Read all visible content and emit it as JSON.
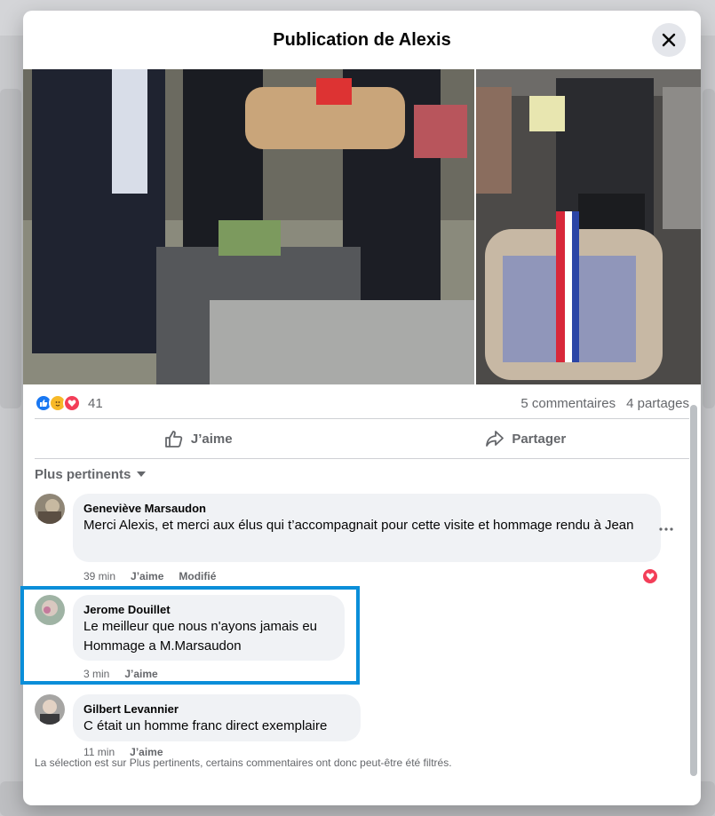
{
  "dialog": {
    "title": "Publication de Alexis"
  },
  "post": {
    "reaction_count": "41",
    "comments_count": "5 commentaires",
    "shares_count": "4 partages",
    "like_label": "J’aime",
    "share_label": "Partager"
  },
  "comments_section": {
    "sort_label": "Plus pertinents",
    "filter_note": "La sélection est sur Plus pertinents, certains commentaires ont donc peut-être été filtrés."
  },
  "comments": [
    {
      "author": "Geneviève Marsaudon",
      "text": "Merci Alexis, et merci aux élus qui t’accompagnait pour cette visite et hommage rendu à Jean",
      "time": "39 min",
      "like_label": "J’aime",
      "edited_label": "Modifié"
    },
    {
      "author": "Jerome Douillet",
      "text": "Le meilleur que nous n'ayons jamais eu Hommage a M.Marsaudon",
      "time": "3 min",
      "like_label": "J’aime"
    },
    {
      "author": "Gilbert Levannier",
      "text": "C était un homme franc direct exemplaire",
      "time": "11 min",
      "like_label": "J’aime"
    }
  ],
  "colors": {
    "facebook_blue": "#1877f2",
    "love_red": "#f33e58",
    "care_yellow": "#f7b928",
    "highlight_border": "#0a8ed9",
    "bubble_bg": "#f0f2f5",
    "secondary_text": "#65676b"
  },
  "icons": {
    "close": "close-icon",
    "like": "thumbs-up-icon",
    "share": "share-arrow-icon",
    "sort": "caret-down-icon",
    "more": "more-dots-icon"
  }
}
